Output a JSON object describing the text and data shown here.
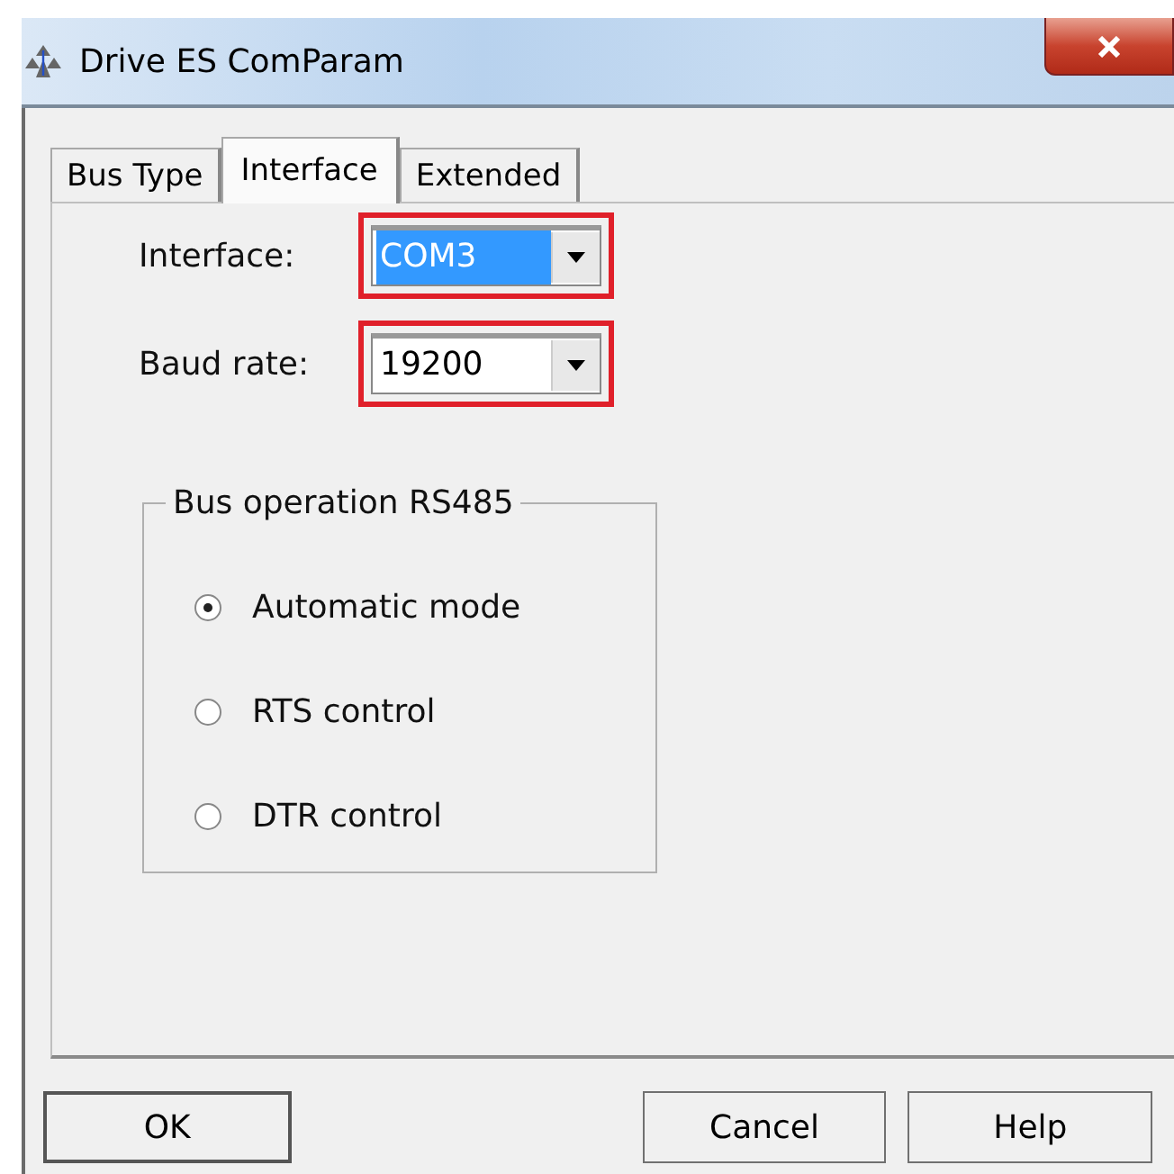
{
  "window": {
    "title": "Drive ES ComParam"
  },
  "tabs": [
    {
      "label": "Bus Type",
      "selected": false
    },
    {
      "label": "Interface",
      "selected": true
    },
    {
      "label": "Extended",
      "selected": false
    }
  ],
  "fields": [
    {
      "label": "Interface:",
      "value": "COM3",
      "focused": true,
      "highlighted": true
    },
    {
      "label": "Baud rate:",
      "value": "19200",
      "focused": false,
      "highlighted": true
    }
  ],
  "group": {
    "title": "Bus operation RS485",
    "options": [
      {
        "label": "Automatic mode",
        "selected": true
      },
      {
        "label": "RTS control",
        "selected": false
      },
      {
        "label": "DTR control",
        "selected": false
      }
    ]
  },
  "buttons": [
    {
      "label": "OK",
      "kind": "default"
    },
    {
      "label": "Cancel",
      "kind": "normal"
    },
    {
      "label": "Help",
      "kind": "normal"
    }
  ]
}
